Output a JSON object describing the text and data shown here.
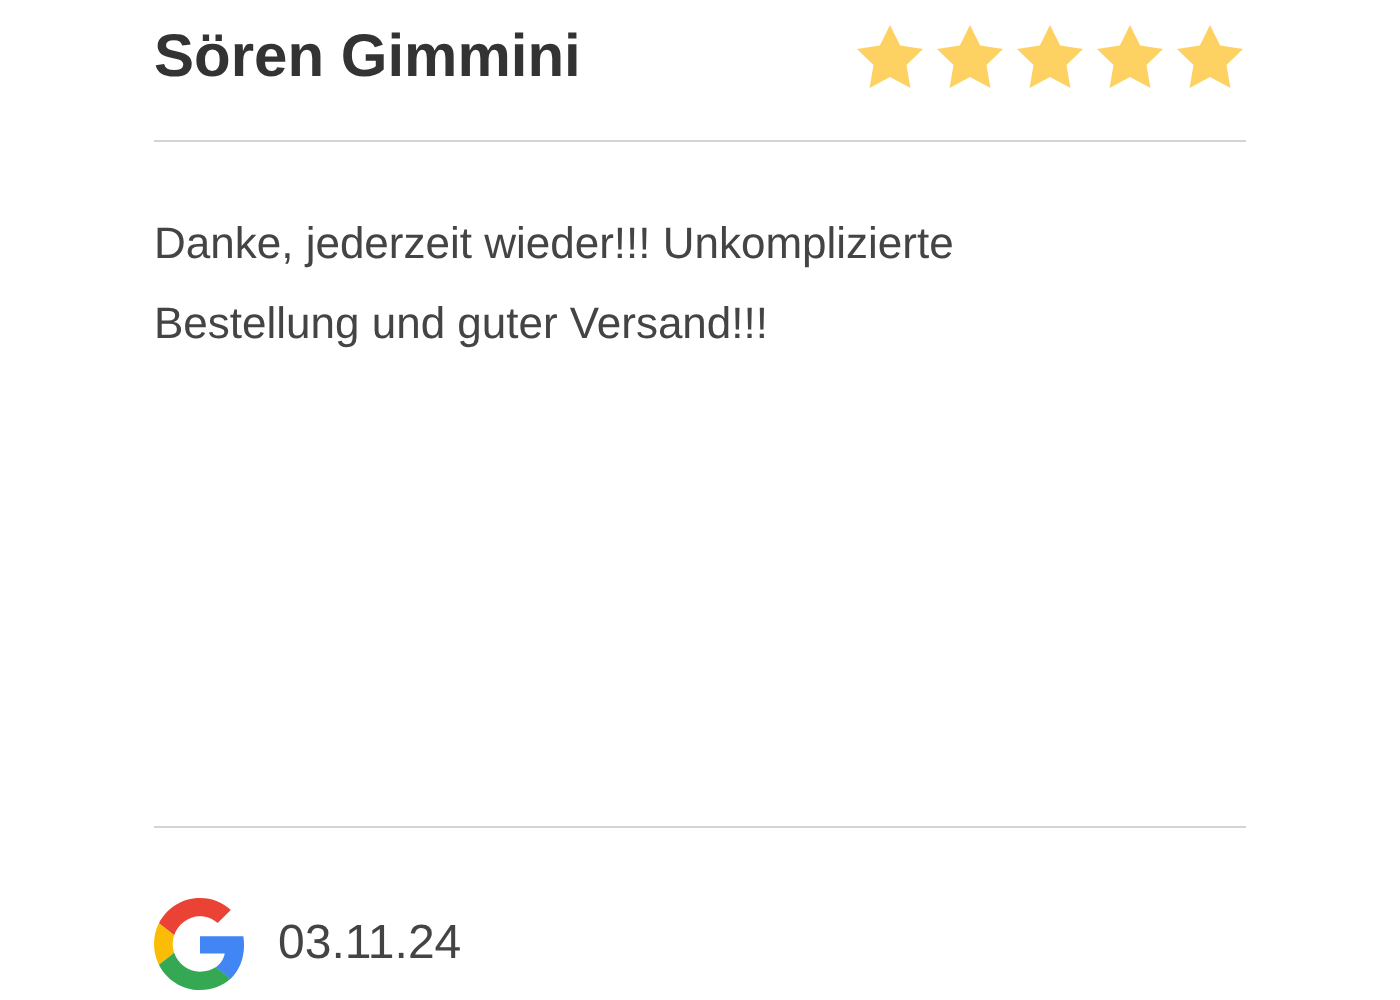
{
  "review": {
    "author": "Sören Gimmini",
    "stars": 5,
    "text": "Danke, jederzeit wieder!!! Unkomplizierte Bestellung und guter Versand!!!",
    "date": "03.11.24"
  }
}
